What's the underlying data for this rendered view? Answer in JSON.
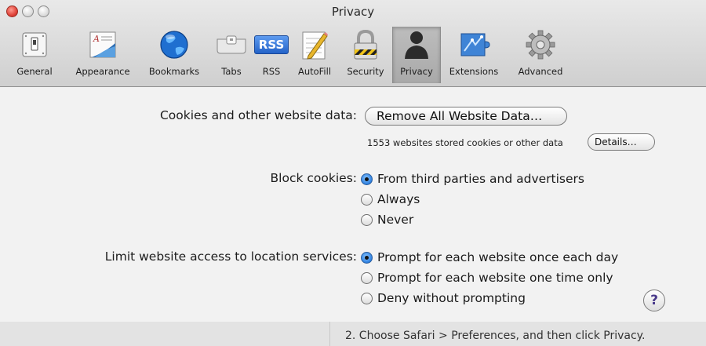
{
  "window": {
    "title": "Privacy"
  },
  "toolbar": {
    "items": [
      {
        "label": "General",
        "icon": "switch-icon"
      },
      {
        "label": "Appearance",
        "icon": "appearance-icon"
      },
      {
        "label": "Bookmarks",
        "icon": "globe-icon"
      },
      {
        "label": "Tabs",
        "icon": "tabs-icon"
      },
      {
        "label": "RSS",
        "icon": "rss-icon"
      },
      {
        "label": "AutoFill",
        "icon": "pencil-icon"
      },
      {
        "label": "Security",
        "icon": "lock-icon"
      },
      {
        "label": "Privacy",
        "icon": "person-silhouette-icon",
        "selected": true
      },
      {
        "label": "Extensions",
        "icon": "extensions-icon"
      },
      {
        "label": "Advanced",
        "icon": "gear-icon"
      }
    ],
    "rss_badge": "RSS"
  },
  "cookies": {
    "label": "Cookies and other website data:",
    "remove_button": "Remove All Website Data…",
    "stored_text": "1553 websites stored cookies or other data",
    "details_button": "Details…"
  },
  "block_cookies": {
    "label": "Block cookies:",
    "options": [
      {
        "label": "From third parties and advertisers",
        "selected": true
      },
      {
        "label": "Always",
        "selected": false
      },
      {
        "label": "Never",
        "selected": false
      }
    ]
  },
  "location": {
    "label": "Limit website access to location services:",
    "options": [
      {
        "label": "Prompt for each website once each day",
        "selected": true
      },
      {
        "label": "Prompt for each website one time only",
        "selected": false
      },
      {
        "label": "Deny without prompting",
        "selected": false
      }
    ]
  },
  "help": {
    "symbol": "?"
  },
  "footer": {
    "instruction": "2.  Choose Safari > Preferences, and then click Privacy."
  },
  "colors": {
    "selected_radio": "#2c7fe0",
    "close_button": "#e0443a"
  }
}
